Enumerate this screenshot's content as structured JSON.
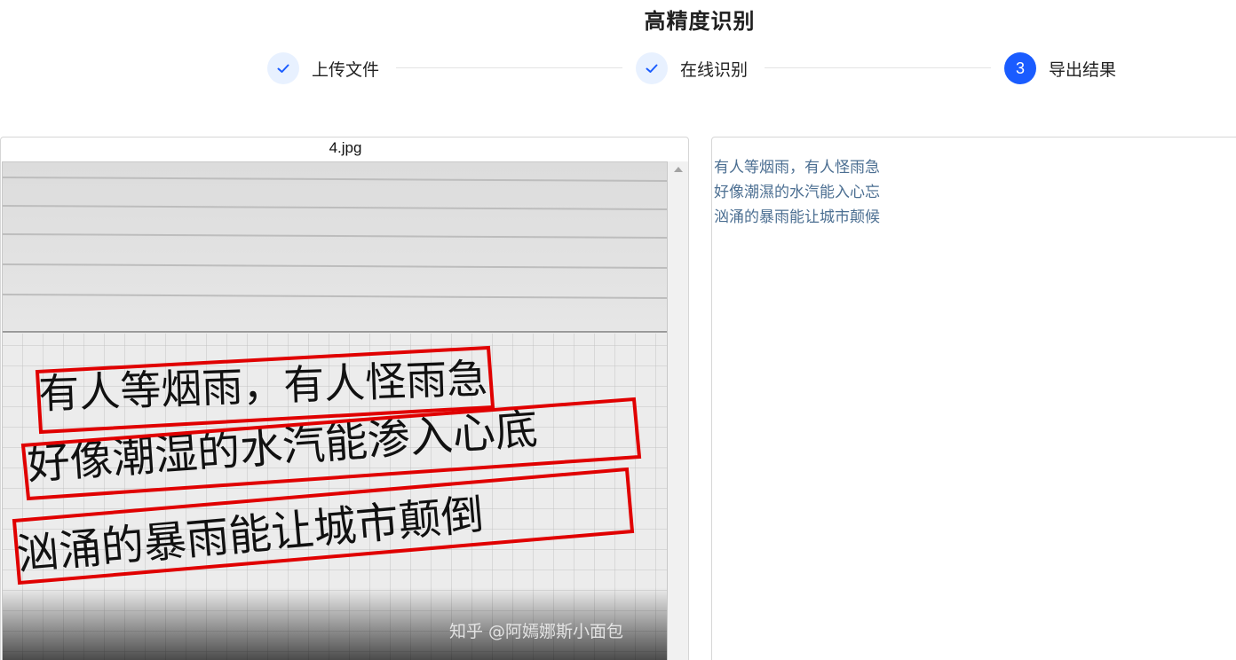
{
  "header": {
    "title": "高精度识别"
  },
  "steps": [
    {
      "label": "上传文件",
      "state": "done",
      "icon": "check-icon"
    },
    {
      "label": "在线识别",
      "state": "done",
      "icon": "check-icon"
    },
    {
      "label": "导出结果",
      "state": "current",
      "number": "3"
    }
  ],
  "preview": {
    "file_name": "4.jpg",
    "handwriting_lines": [
      "有人等烟雨，有人怪雨急",
      "好像潮湿的水汽能渗入心底",
      "汹涌的暴雨能让城市颠倒"
    ],
    "watermark": "知乎 @阿嫣娜斯小面包"
  },
  "result": {
    "lines": [
      "有人等烟雨，有人怪雨急",
      "好像潮濕的水汽能入心忘",
      "汹涌的暴雨能让城市颠候"
    ]
  },
  "colors": {
    "accent": "#1a5cff",
    "step_done_bg": "#e8f1ff",
    "result_text": "#4c6f92",
    "detection_box": "#e00000"
  }
}
